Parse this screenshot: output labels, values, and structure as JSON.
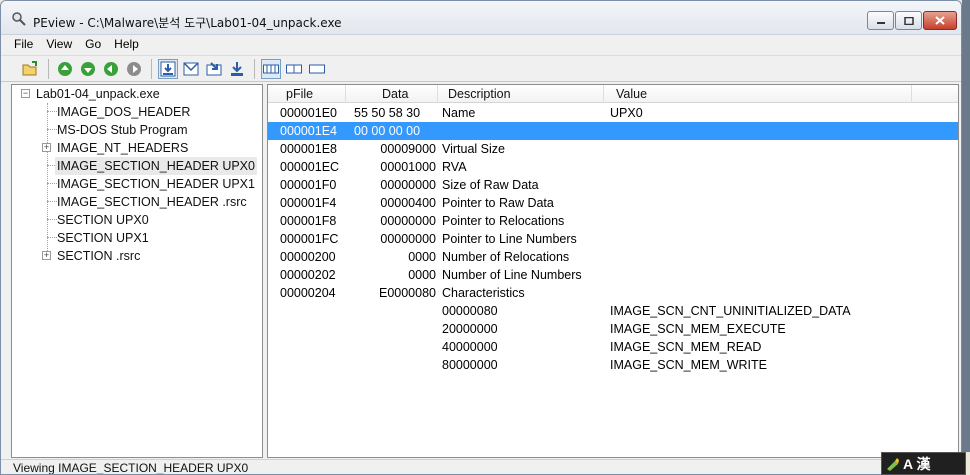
{
  "window": {
    "title": "PEview - C:\\Malware\\분석 도구\\Lab01-04_unpack.exe"
  },
  "menu": [
    "File",
    "View",
    "Go",
    "Help"
  ],
  "toolbar": {
    "icons": [
      "open-icon",
      "home-icon",
      "back-icon",
      "forward-icon",
      "next-icon",
      "view-hex-icon",
      "view-header-icon",
      "view-section-icon",
      "view-export-icon",
      "view-byte-icon",
      "view-word-icon",
      "view-dword-icon"
    ]
  },
  "tree": {
    "items": [
      {
        "label": "Lab01-04_unpack.exe",
        "expander": "-"
      },
      {
        "label": "IMAGE_DOS_HEADER",
        "expander": ""
      },
      {
        "label": "MS-DOS Stub Program",
        "expander": ""
      },
      {
        "label": "IMAGE_NT_HEADERS",
        "expander": "+"
      },
      {
        "label": "IMAGE_SECTION_HEADER UPX0",
        "expander": ""
      },
      {
        "label": "IMAGE_SECTION_HEADER UPX1",
        "expander": ""
      },
      {
        "label": "IMAGE_SECTION_HEADER .rsrc",
        "expander": ""
      },
      {
        "label": "SECTION UPX0",
        "expander": ""
      },
      {
        "label": "SECTION UPX1",
        "expander": ""
      },
      {
        "label": "SECTION .rsrc",
        "expander": "+"
      }
    ]
  },
  "table": {
    "columns": [
      "pFile",
      "Data",
      "Description",
      "Value"
    ],
    "rows": [
      {
        "pfile": "000001E0",
        "data": "55  50  58  30",
        "desc": "Name",
        "value": "UPX0"
      },
      {
        "pfile": "000001E4",
        "data": "00  00  00  00",
        "desc": "",
        "value": ""
      },
      {
        "pfile": "000001E8",
        "data": "00009000",
        "desc": "Virtual Size",
        "value": ""
      },
      {
        "pfile": "000001EC",
        "data": "00001000",
        "desc": "RVA",
        "value": ""
      },
      {
        "pfile": "000001F0",
        "data": "00000000",
        "desc": "Size of Raw Data",
        "value": ""
      },
      {
        "pfile": "000001F4",
        "data": "00000400",
        "desc": "Pointer to Raw Data",
        "value": ""
      },
      {
        "pfile": "000001F8",
        "data": "00000000",
        "desc": "Pointer to Relocations",
        "value": ""
      },
      {
        "pfile": "000001FC",
        "data": "00000000",
        "desc": "Pointer to Line Numbers",
        "value": ""
      },
      {
        "pfile": "00000200",
        "data": "0000",
        "desc": "Number of Relocations",
        "value": ""
      },
      {
        "pfile": "00000202",
        "data": "0000",
        "desc": "Number of Line Numbers",
        "value": ""
      },
      {
        "pfile": "00000204",
        "data": "E0000080",
        "desc": "Characteristics",
        "value": ""
      },
      {
        "pfile": "",
        "data": "",
        "desc": "00000080",
        "value": "IMAGE_SCN_CNT_UNINITIALIZED_DATA"
      },
      {
        "pfile": "",
        "data": "",
        "desc": "20000000",
        "value": "IMAGE_SCN_MEM_EXECUTE"
      },
      {
        "pfile": "",
        "data": "",
        "desc": "40000000",
        "value": "IMAGE_SCN_MEM_READ"
      },
      {
        "pfile": "",
        "data": "",
        "desc": "80000000",
        "value": "IMAGE_SCN_MEM_WRITE"
      }
    ]
  },
  "status": {
    "text": "Viewing IMAGE_SECTION_HEADER UPX0"
  },
  "ime": {
    "label": "A 漢"
  },
  "colors": {
    "selection": "#3399ff",
    "tree_selection": "#e9e9e9"
  }
}
